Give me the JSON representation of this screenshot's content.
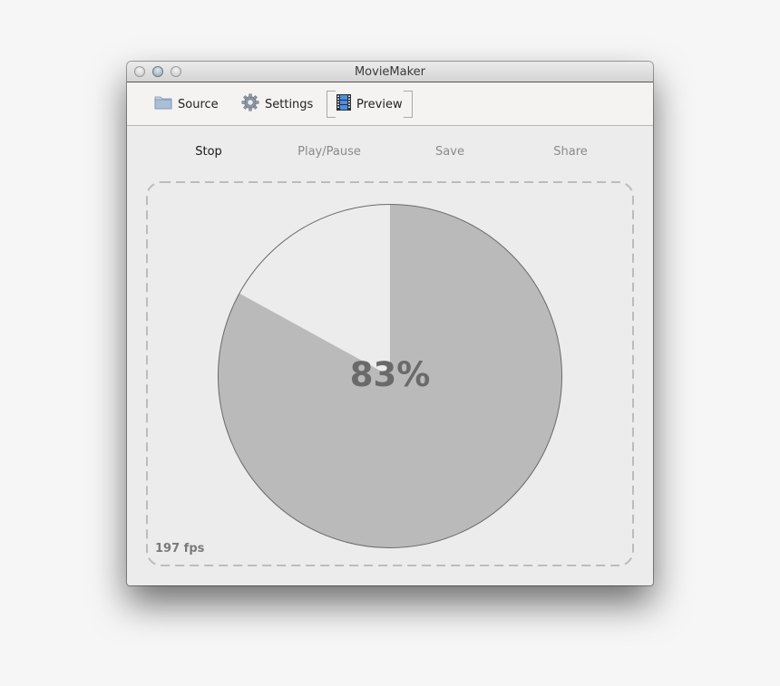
{
  "window": {
    "title": "MovieMaker"
  },
  "toolbar": {
    "items": [
      {
        "label": "Source",
        "icon": "folder-icon"
      },
      {
        "label": "Settings",
        "icon": "gear-icon"
      },
      {
        "label": "Preview",
        "icon": "film-icon",
        "selected": true
      }
    ]
  },
  "actions": [
    {
      "label": "Stop",
      "enabled": true
    },
    {
      "label": "Play/Pause",
      "enabled": false
    },
    {
      "label": "Save",
      "enabled": false
    },
    {
      "label": "Share",
      "enabled": false
    }
  ],
  "preview": {
    "progress_percent": 83,
    "progress_label": "83%",
    "fps_label": "197 fps",
    "colors": {
      "filled": "#bababa",
      "empty": "#ececec",
      "outline": "#6a6a6a",
      "border": "#bcbcbc"
    }
  }
}
